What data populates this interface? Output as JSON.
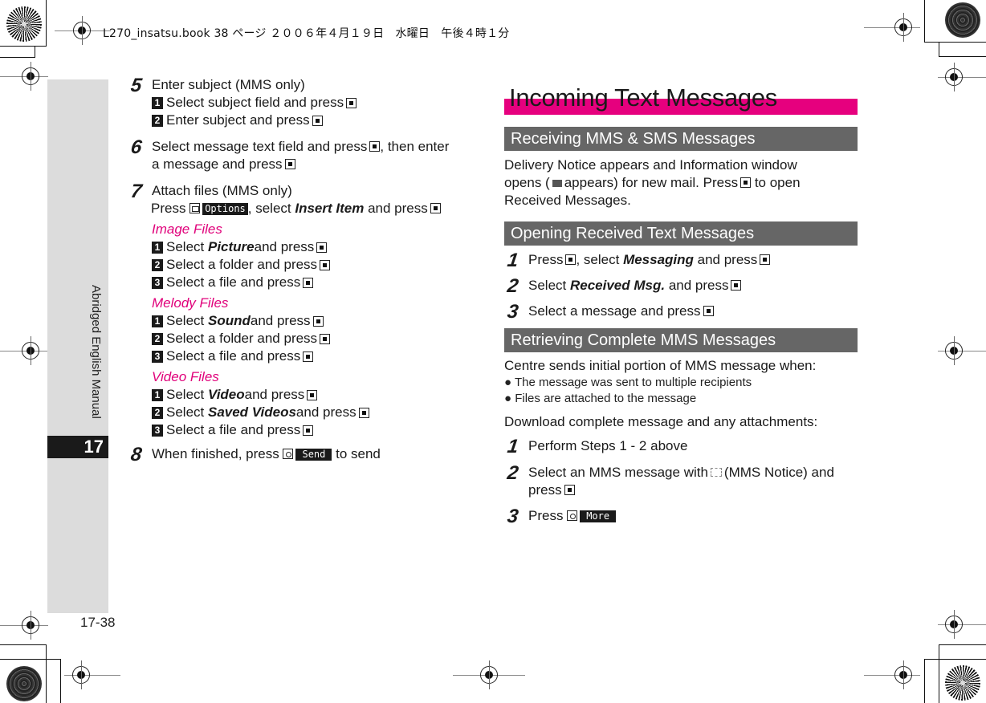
{
  "print_header": "L270_insatsu.book 38 ページ ２００６年４月１９日　水曜日　午後４時１分",
  "side_tab": {
    "label": "Abridged English Manual",
    "chapter": "17"
  },
  "page_number": "17-38",
  "left_column": {
    "step5": {
      "num": "5",
      "title": "Enter subject (MMS only)",
      "subs": [
        {
          "num": "1",
          "text": "Select subject field and press"
        },
        {
          "num": "2",
          "text": "Enter subject and press"
        }
      ]
    },
    "step6": {
      "num": "6",
      "line1": "Select message text field and press",
      "line1_after": ", then enter",
      "line2": "a message and press"
    },
    "step7": {
      "num": "7",
      "title": "Attach files (MMS only)",
      "press": "Press",
      "softkey": "Options",
      "select": ", select",
      "item": "Insert Item",
      "and_press": "and press",
      "groups": [
        {
          "heading": "Image Files",
          "subs": [
            {
              "num": "1",
              "pre": "Select ",
              "em": "Picture",
              "post": " and press"
            },
            {
              "num": "2",
              "pre": "Select a folder and press",
              "em": "",
              "post": ""
            },
            {
              "num": "3",
              "pre": "Select a file and press",
              "em": "",
              "post": ""
            }
          ]
        },
        {
          "heading": "Melody Files",
          "subs": [
            {
              "num": "1",
              "pre": "Select ",
              "em": "Sound",
              "post": " and press"
            },
            {
              "num": "2",
              "pre": "Select a folder and press",
              "em": "",
              "post": ""
            },
            {
              "num": "3",
              "pre": "Select a file and press",
              "em": "",
              "post": ""
            }
          ]
        },
        {
          "heading": "Video Files",
          "subs": [
            {
              "num": "1",
              "pre": "Select ",
              "em": "Video",
              "post": " and press"
            },
            {
              "num": "2",
              "pre": "Select ",
              "em": "Saved Videos",
              "post": " and press"
            },
            {
              "num": "3",
              "pre": "Select a file and press",
              "em": "",
              "post": ""
            }
          ]
        }
      ]
    },
    "step8": {
      "num": "8",
      "pre": "When finished, press",
      "softkey": "Send",
      "post": "to send"
    }
  },
  "right_column": {
    "title": "Incoming Text Messages",
    "sections": {
      "receiving": {
        "heading": "Receiving MMS & SMS Messages",
        "p1": "Delivery Notice appears and Information window",
        "p2a": "opens (",
        "p2b": "appears) for new mail. Press",
        "p2c": "to open",
        "p3": "Received Messages."
      },
      "opening": {
        "heading": "Opening Received Text Messages",
        "steps": [
          {
            "num": "1",
            "pre": "Press",
            "mid": ", select ",
            "em": "Messaging",
            "post": " and press"
          },
          {
            "num": "2",
            "pre": "Select ",
            "em": "Received Msg.",
            "post": " and press"
          },
          {
            "num": "3",
            "pre": "Select a message and press",
            "em": "",
            "post": ""
          }
        ]
      },
      "retrieving": {
        "heading": "Retrieving Complete MMS Messages",
        "intro": "Centre sends initial portion of MMS message when:",
        "bullets": [
          "The message was sent to multiple recipients",
          "Files are attached to the message"
        ],
        "download": "Download complete message and any attachments:",
        "steps": [
          {
            "num": "1",
            "text": "Perform Steps 1 - 2 above"
          },
          {
            "num": "2",
            "pre": "Select an MMS message with",
            "post": "(MMS Notice) and",
            "line2": "press"
          },
          {
            "num": "3",
            "pre": "Press",
            "softkey": "More"
          }
        ]
      }
    }
  },
  "colors": {
    "accent_pink": "#e6007e",
    "section_gray": "#666666",
    "side_tab_gray": "#dcdcdc"
  }
}
